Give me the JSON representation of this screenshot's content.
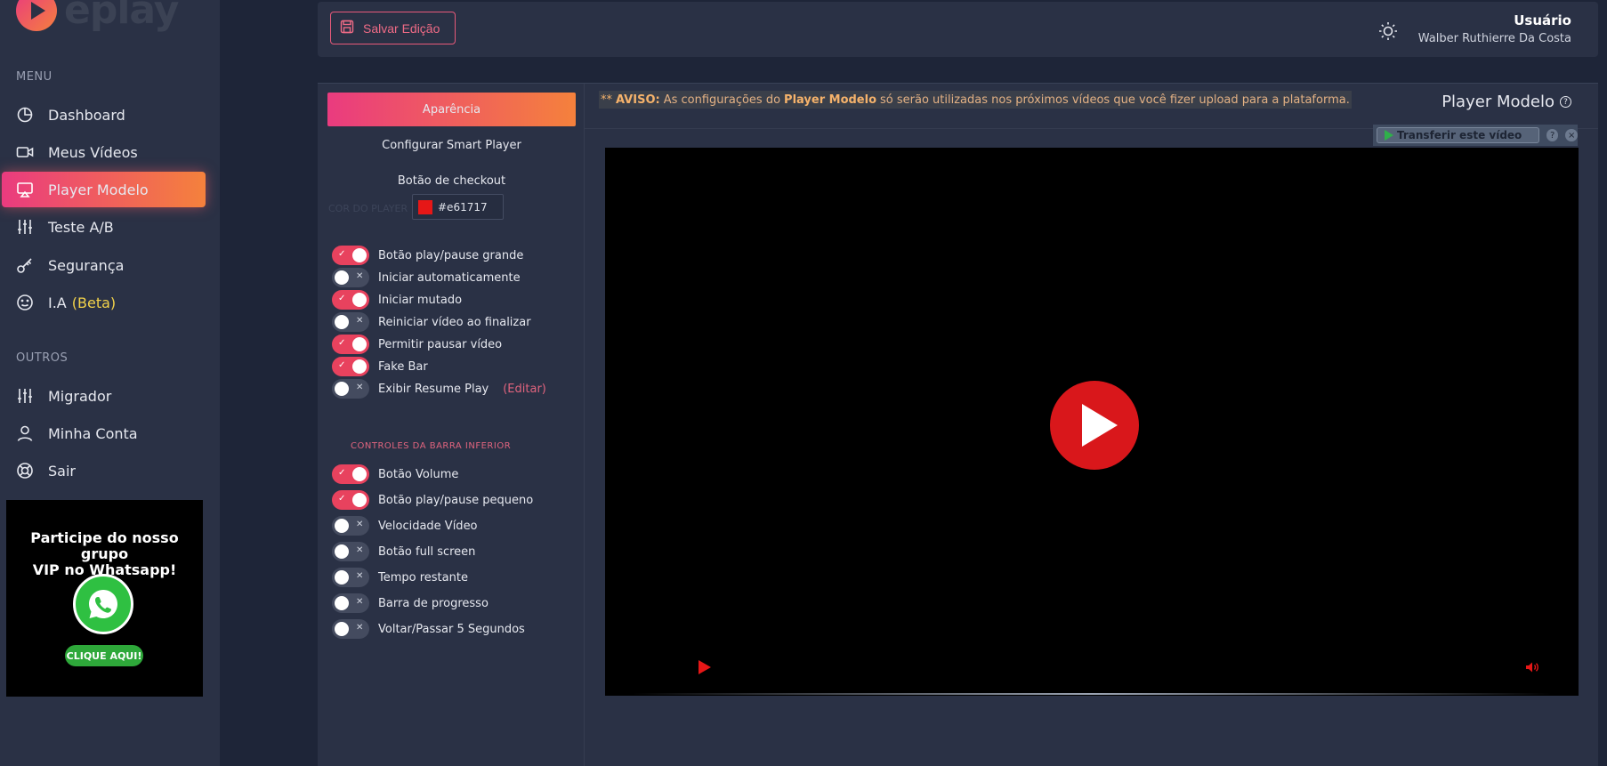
{
  "brand": {
    "logo_text": "eplay"
  },
  "sidebar": {
    "menu_label": "MENU",
    "items": [
      {
        "label": "Dashboard",
        "icon": "pie-chart-icon"
      },
      {
        "label": "Meus Vídeos",
        "icon": "video-camera-icon"
      },
      {
        "label": "Player Modelo",
        "icon": "cast-icon",
        "active": true
      },
      {
        "label": "Teste A/B",
        "icon": "sliders-icon"
      },
      {
        "label": "Segurança",
        "icon": "key-icon"
      },
      {
        "label": "I.A",
        "badge": "(Beta)",
        "icon": "smile-icon"
      }
    ],
    "others_label": "OUTROS",
    "others": [
      {
        "label": "Migrador",
        "icon": "sliders-icon"
      },
      {
        "label": "Minha Conta",
        "icon": "user-icon"
      },
      {
        "label": "Sair",
        "icon": "lifebuoy-icon"
      }
    ],
    "promo": {
      "title_line1": "Participe do nosso grupo",
      "title_line2": "VIP no Whatsapp!",
      "cta": "CLIQUE AQUI!"
    }
  },
  "header": {
    "save_label": "Salvar Edição",
    "user_title": "Usuário",
    "user_name": "Walber Ruthierre Da Costa"
  },
  "settings": {
    "tabs": [
      "Aparência",
      "Configurar Smart Player",
      "Botão de checkout"
    ],
    "color_label": "COR DO PLAYER",
    "color_value": "#e61717",
    "toggles_top": [
      {
        "label": "Botão play/pause grande",
        "on": true
      },
      {
        "label": "Iniciar automaticamente",
        "on": false
      },
      {
        "label": "Iniciar mutado",
        "on": true
      },
      {
        "label": "Reiniciar vídeo ao finalizar",
        "on": false
      },
      {
        "label": "Permitir pausar vídeo",
        "on": true
      },
      {
        "label": "Fake Bar",
        "on": true
      },
      {
        "label": "Exibir Resume Play",
        "on": false,
        "link": "(Editar)"
      }
    ],
    "group_heading": "CONTROLES DA BARRA INFERIOR",
    "toggles_bottom": [
      {
        "label": "Botão Volume",
        "on": true
      },
      {
        "label": "Botão play/pause pequeno",
        "on": true
      },
      {
        "label": "Velocidade Vídeo",
        "on": false
      },
      {
        "label": "Botão full screen",
        "on": false
      },
      {
        "label": "Tempo restante",
        "on": false
      },
      {
        "label": "Barra de progresso",
        "on": false
      },
      {
        "label": "Voltar/Passar 5 Segundos",
        "on": false
      }
    ]
  },
  "preview": {
    "notice_prefix": "**",
    "notice_strong": "AVISO:",
    "notice_text1": "As configurações do",
    "notice_highlight": "Player Modelo",
    "notice_text2": "só serão utilizadas nos próximos vídeos que você fizer upload para a plataforma.",
    "title": "Player Modelo",
    "transfer_label": "Transferir este vídeo"
  },
  "colors": {
    "accent_start": "#ea3b7f",
    "accent_end": "#f5813c",
    "player": "#e61717"
  }
}
